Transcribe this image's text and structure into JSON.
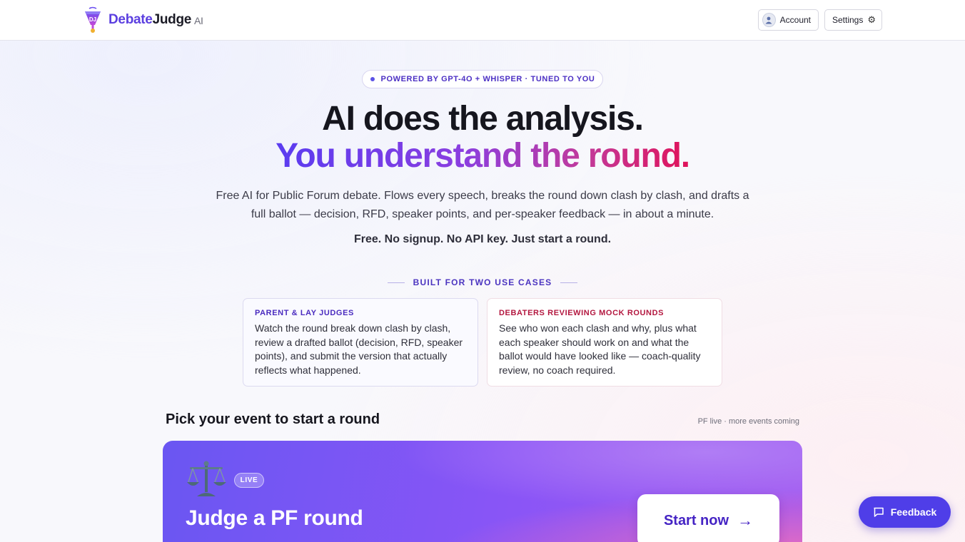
{
  "header": {
    "brand_part1": "Debate",
    "brand_part2": "Judge",
    "brand_suffix": "AI",
    "logo_monogram": "DJ",
    "account_label": "Account",
    "settings_label": "Settings",
    "settings_icon": "⚙"
  },
  "hero": {
    "pill": "POWERED BY GPT-4O + WHISPER · TUNED TO YOU",
    "headline_1": "AI does the analysis.",
    "headline_2": "You understand the round.",
    "lede": "Free AI for Public Forum debate. Flows every speech, breaks the round down clash by clash, and drafts a full ballot — decision, RFD, speaker points, and per-speaker feedback — in about a minute.",
    "tagline": "Free. No signup. No API key. Just start a round."
  },
  "use_cases": {
    "label": "BUILT FOR TWO USE CASES",
    "cards": [
      {
        "title": "PARENT & LAY JUDGES",
        "body": "Watch the round break down clash by clash, review a drafted ballot (decision, RFD, speaker points), and submit the version that actually reflects what happened."
      },
      {
        "title": "DEBATERS REVIEWING MOCK ROUNDS",
        "body": "See who won each clash and why, plus what each speaker should work on and what the ballot would have looked like — coach-quality review, no coach required."
      }
    ]
  },
  "events": {
    "title": "Pick your event to start a round",
    "note": "PF live · more events coming",
    "card": {
      "badge": "LIVE",
      "title": "Judge a PF round",
      "cta": "Start now",
      "cta_arrow": "→"
    }
  },
  "feedback_label": "Feedback",
  "colors": {
    "brand_purple": "#5b3fe0",
    "gradient_start": "#5a3cf0",
    "gradient_end": "#e0135a",
    "feedback_bg": "#4f3ee8"
  }
}
